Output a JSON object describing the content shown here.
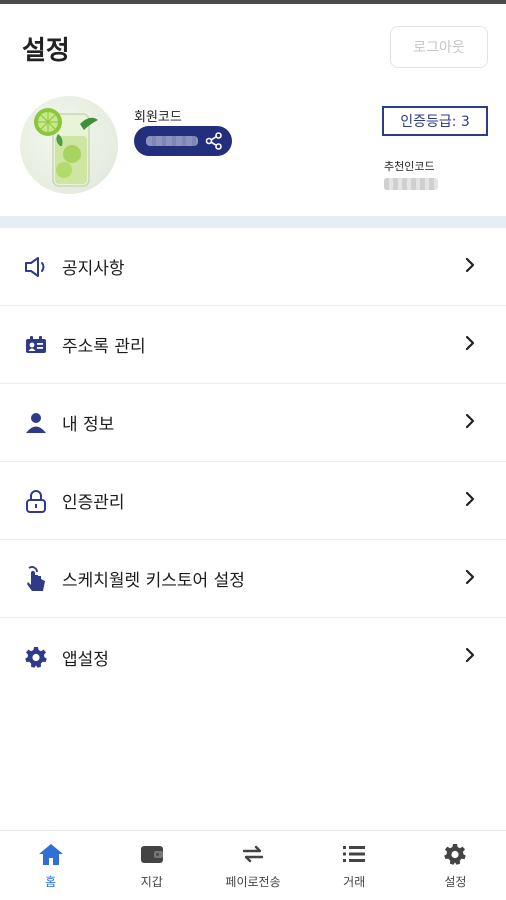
{
  "header": {
    "title": "설정",
    "logout_label": "로그아웃"
  },
  "profile": {
    "member_code_label": "회원코드",
    "grade_label": "인증등급: 3",
    "referral_label": "추천인코드"
  },
  "menu": {
    "items": [
      {
        "label": "공지사항",
        "icon": "speaker-icon"
      },
      {
        "label": "주소록 관리",
        "icon": "address-book-icon"
      },
      {
        "label": "내 정보",
        "icon": "person-icon"
      },
      {
        "label": "인증관리",
        "icon": "lock-icon"
      },
      {
        "label": "스케치월렛 키스토어 설정",
        "icon": "touch-icon"
      },
      {
        "label": "앱설정",
        "icon": "gear-icon"
      }
    ]
  },
  "bottom_nav": {
    "items": [
      {
        "label": "홈",
        "icon": "home-icon",
        "active": true
      },
      {
        "label": "지갑",
        "icon": "wallet-icon",
        "active": false
      },
      {
        "label": "페이로전송",
        "icon": "transfer-icon",
        "active": false
      },
      {
        "label": "거래",
        "icon": "list-icon",
        "active": false
      },
      {
        "label": "설정",
        "icon": "settings-icon",
        "active": false
      }
    ]
  },
  "colors": {
    "brand_navy": "#232f7d",
    "active_blue": "#2f6fd8",
    "divider": "#e7edf5"
  }
}
